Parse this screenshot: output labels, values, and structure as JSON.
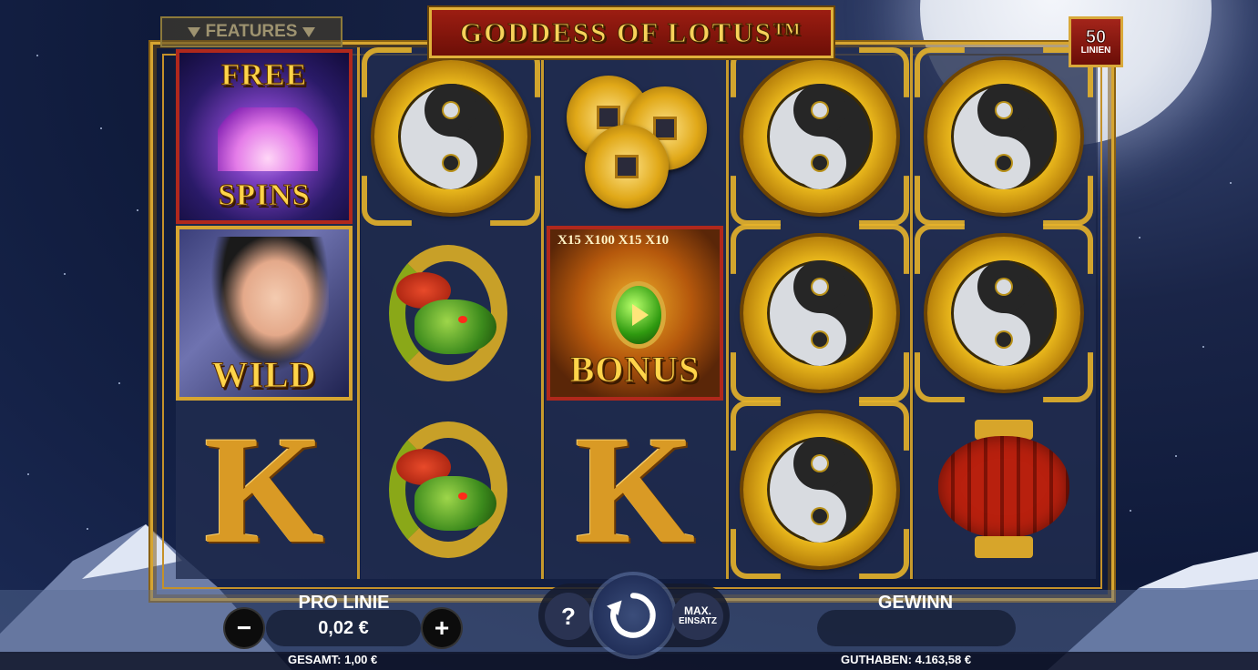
{
  "game": {
    "title": "GODDESS OF LOTUS™",
    "features_label": "FEATURES",
    "lines_count": "50",
    "lines_label": "LINIEN"
  },
  "reels": [
    [
      "free-spins",
      "wild",
      "k"
    ],
    [
      "yin-yang",
      "dragon",
      "dragon"
    ],
    [
      "coins",
      "bonus",
      "k"
    ],
    [
      "yin-yang",
      "yin-yang",
      "yin-yang"
    ],
    [
      "yin-yang",
      "yin-yang",
      "lantern"
    ]
  ],
  "symbols": {
    "free_top": "FREE",
    "free_bottom": "SPINS",
    "wild": "WILD",
    "bonus": "BONUS",
    "bonus_wheel": "X15  X100  X15  X10",
    "k": "K"
  },
  "controls": {
    "pro_linie_label": "PRO LINIE",
    "bet_value": "0,02 €",
    "minus": "−",
    "plus": "+",
    "help": "?",
    "max_line1": "MAX.",
    "max_line2": "EINSATZ",
    "gewinn_label": "GEWINN",
    "gewinn_value": "",
    "gesamt": "GESAMT: 1,00 €",
    "guthaben": "GUTHABEN: 4.163,58 €"
  },
  "colors": {
    "gold": "#d6a531",
    "banner_red": "#9c1d12",
    "background": "#0f1a3a"
  }
}
